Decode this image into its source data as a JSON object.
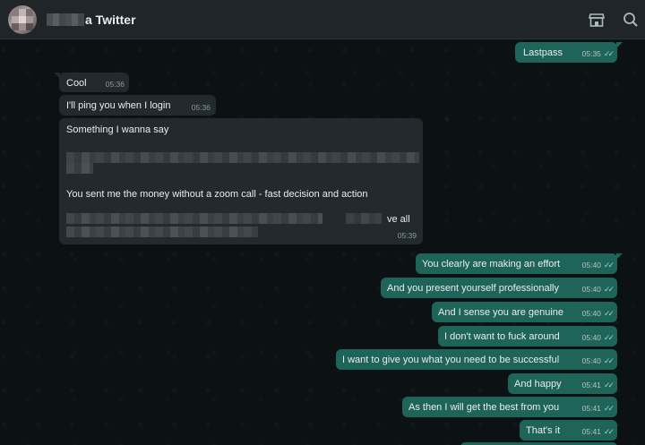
{
  "header": {
    "contact_name": "a Twitter",
    "icons": [
      "avatar",
      "shop-icon",
      "search-icon"
    ]
  },
  "messages": [
    {
      "dir": "out",
      "text": "Lastpass",
      "time": "05:35",
      "ticks": "✓✓"
    },
    {
      "dir": "in",
      "text": "Cool",
      "time": "05:36"
    },
    {
      "dir": "in",
      "text": "I'll ping you when I login",
      "time": "05:36"
    },
    {
      "dir": "in",
      "lines": [
        "Something I wanna say",
        "You sent me the money without a zoom call - fast decision and action",
        "ve all"
      ],
      "time": "05:39"
    },
    {
      "dir": "out",
      "text": "You clearly are making an effort",
      "time": "05:40",
      "ticks": "✓✓"
    },
    {
      "dir": "out",
      "text": "And you present yourself professionally",
      "time": "05:40",
      "ticks": "✓✓"
    },
    {
      "dir": "out",
      "text": "And I sense you are genuine",
      "time": "05:40",
      "ticks": "✓✓"
    },
    {
      "dir": "out",
      "text": "I don't want to fuck around",
      "time": "05:40",
      "ticks": "✓✓"
    },
    {
      "dir": "out",
      "text": "I want to give you what you need to be successful",
      "time": "05:40",
      "ticks": "✓✓"
    },
    {
      "dir": "out",
      "text": "And happy",
      "time": "05:41",
      "ticks": "✓✓"
    },
    {
      "dir": "out",
      "text": "As then I will get the best from you",
      "time": "05:41",
      "ticks": "✓✓"
    },
    {
      "dir": "out",
      "text": "That's it",
      "time": "05:41",
      "ticks": "✓✓"
    }
  ],
  "colors": {
    "header_bg": "#1f2528",
    "chat_bg": "#0c1214",
    "incoming_bubble": "#232a2e",
    "outgoing_bubble": "#1f6459"
  }
}
